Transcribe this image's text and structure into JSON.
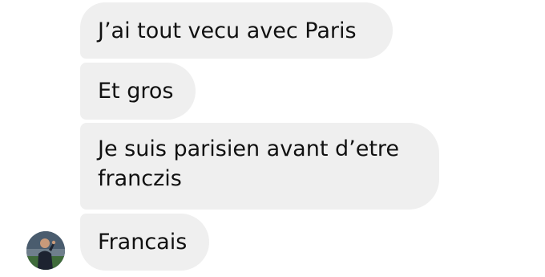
{
  "conversation": {
    "messages": [
      {
        "lines": [
          "J’ai tout vecu avec Paris"
        ]
      },
      {
        "lines": [
          "Et gros"
        ]
      },
      {
        "lines": [
          "Je suis parisien avant d’etre",
          "franczis"
        ]
      },
      {
        "lines": [
          "Francais"
        ]
      }
    ],
    "sender": {
      "avatar_icon": "profile-photo-icon",
      "bubble_color": "#efefef",
      "text_color": "#111111"
    }
  }
}
